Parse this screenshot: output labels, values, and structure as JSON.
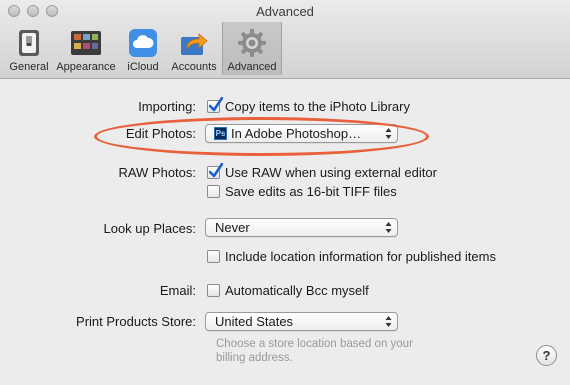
{
  "window": {
    "title": "Advanced"
  },
  "tabs": [
    {
      "label": "General",
      "icon": "switch-icon"
    },
    {
      "label": "Appearance",
      "icon": "appearance-icon"
    },
    {
      "label": "iCloud",
      "icon": "cloud-icon"
    },
    {
      "label": "Accounts",
      "icon": "share-arrow-icon"
    },
    {
      "label": "Advanced",
      "icon": "gear-icon",
      "active": true
    }
  ],
  "importing": {
    "label": "Importing:",
    "checkbox_label": "Copy items to the iPhoto Library",
    "checked": true
  },
  "edit_photos": {
    "label": "Edit Photos:",
    "value": "In Adobe Photoshop…",
    "icon": "ps-icon",
    "icon_text": "Ps"
  },
  "raw_photos": {
    "label": "RAW Photos:",
    "use_raw_label": "Use RAW when using external editor",
    "use_raw_checked": true,
    "save_16bit_label": "Save edits as 16-bit TIFF files",
    "save_16bit_checked": false
  },
  "look_up_places": {
    "label": "Look up Places:",
    "value": "Never",
    "include_location_label": "Include location information for published items",
    "include_location_checked": false
  },
  "email": {
    "label": "Email:",
    "checkbox_label": "Automatically Bcc myself",
    "checked": false
  },
  "print_products": {
    "label": "Print Products Store:",
    "value": "United States",
    "hint_line1": "Choose a store location based on your",
    "hint_line2": "billing address."
  },
  "help": {
    "label": "?"
  },
  "colors": {
    "highlight_ellipse": "#e8603c",
    "checkmark": "#1c5fd0"
  }
}
